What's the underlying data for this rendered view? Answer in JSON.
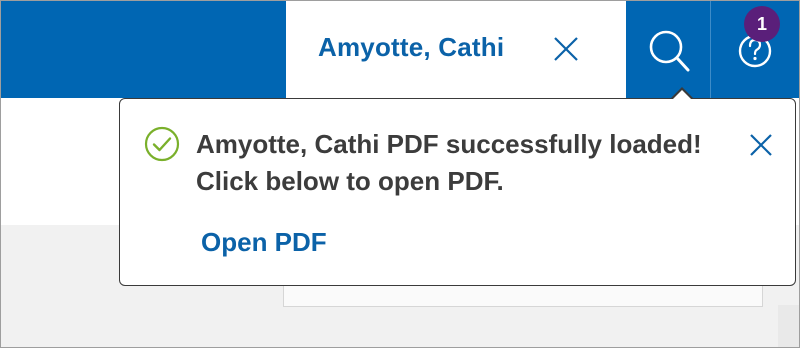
{
  "colors": {
    "brand_blue": "#0066b3",
    "link_blue": "#0b62a8",
    "badge_purple": "#5a1f7a",
    "success_green": "#7ab02b",
    "text_dark": "#3c3c3c"
  },
  "header": {
    "patient_tab": {
      "name": "Amyotte, Cathi",
      "close_icon": "close-icon"
    },
    "search": {
      "icon": "search-icon"
    },
    "help": {
      "icon": "help-circle-icon",
      "badge_count": "1"
    }
  },
  "toast": {
    "status_icon": "check-circle-icon",
    "message": "Amyotte, Cathi PDF successfully loaded! Click below to open PDF.",
    "link_label": "Open PDF",
    "close_icon": "close-icon"
  }
}
